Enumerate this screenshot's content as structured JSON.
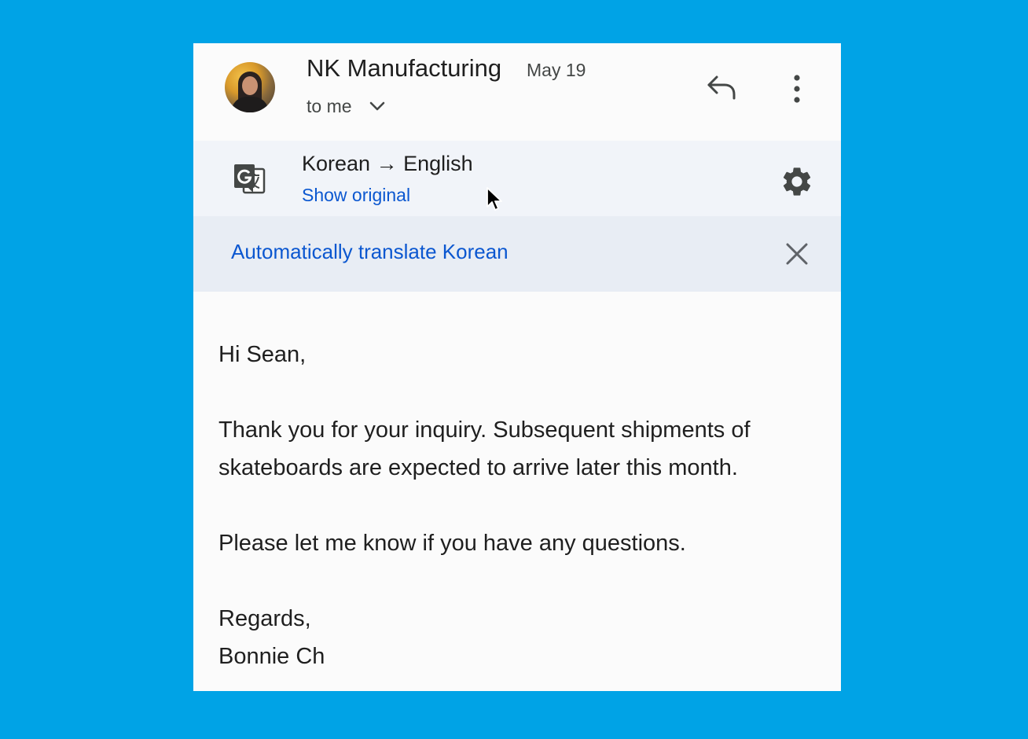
{
  "header": {
    "sender": "NK Manufacturing",
    "date": "May 19",
    "recipient": "to me"
  },
  "translation": {
    "source_language": "Korean",
    "arrow": "→",
    "target_language": "English",
    "show_original": "Show original"
  },
  "auto_translate": {
    "label": "Automatically translate Korean"
  },
  "email": {
    "greeting": "Hi Sean,",
    "paragraph1": "Thank you for your inquiry. Subsequent shipments of skateboards are expected to arrive later this month.",
    "paragraph2": "Please let me know if you have any questions.",
    "closing": "Regards,",
    "signature": "Bonnie Ch"
  },
  "colors": {
    "background": "#00a3e6",
    "link": "#0b57d0",
    "translate_bar": "#f1f4f9",
    "auto_bar": "#e8edf4"
  }
}
